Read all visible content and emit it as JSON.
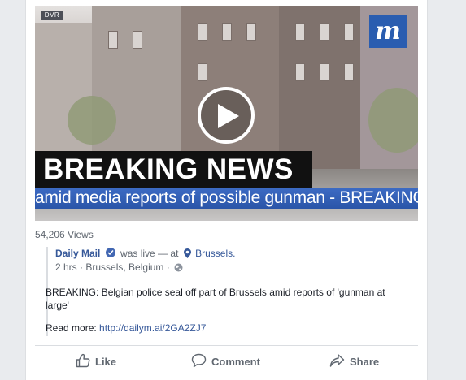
{
  "video": {
    "badge": "DVR",
    "logo_letter": "m",
    "headline": "BREAKING NEWS",
    "ticker": "amid media reports of possible gunman - BREAKING NEWS- Belgian"
  },
  "stats": {
    "views": "54,206 Views"
  },
  "shared_post": {
    "author": "Daily Mail",
    "status_text": "was live — at",
    "place": "Brussels.",
    "time": "2 hrs",
    "location": "Brussels, Belgium",
    "separator": "·",
    "body": "BREAKING: Belgian police seal off part of Brussels amid reports of 'gunman at large'",
    "read_more_label": "Read more:",
    "link": "http://dailym.ai/2GA2ZJ7"
  },
  "actions": {
    "like": "Like",
    "comment": "Comment",
    "share": "Share"
  },
  "colors": {
    "link": "#365899",
    "ticker_blue": "#2a55a8",
    "logo_blue": "#2a5db0"
  }
}
